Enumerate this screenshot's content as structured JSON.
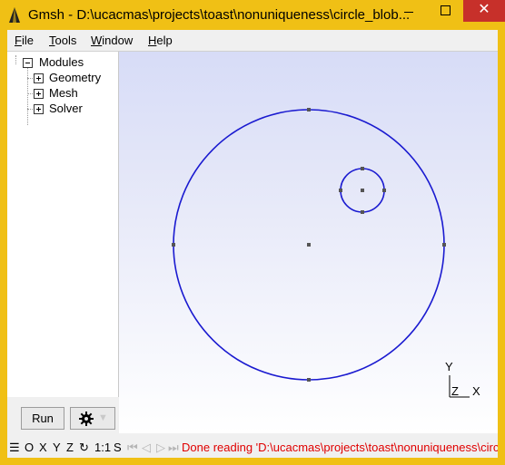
{
  "window": {
    "title": "Gmsh - D:\\ucacmas\\projects\\toast\\nonuniqueness\\circle_blob...",
    "close_glyph": "✕",
    "colors": {
      "frame": "#f0c015",
      "close": "#c7302a"
    }
  },
  "menu": {
    "file": "File",
    "tools": "Tools",
    "window": "Window",
    "help": "Help"
  },
  "tree": {
    "root": "Modules",
    "items": [
      {
        "label": "Geometry"
      },
      {
        "label": "Mesh"
      },
      {
        "label": "Solver"
      }
    ]
  },
  "buttons": {
    "run": "Run",
    "options_arrow": "▼"
  },
  "graphics": {
    "axes": {
      "y": "Y",
      "z": "Z",
      "x": "X"
    },
    "curve_color": "#1a1ad0",
    "point_color": "#555555"
  },
  "statusbar": {
    "menu_glyph": "☰",
    "o": "O",
    "x": "X",
    "y": "Y",
    "z": "Z",
    "rotate_glyph": "↻",
    "scale": "1:1",
    "s": "S",
    "nav_first": "⏮",
    "nav_prev": "◁",
    "nav_next": "▷",
    "nav_last": "⏭",
    "message": "Done reading 'D:\\ucacmas\\projects\\toast\\nonuniqueness\\circle_blob.geo'",
    "message_color": "#e00000"
  }
}
